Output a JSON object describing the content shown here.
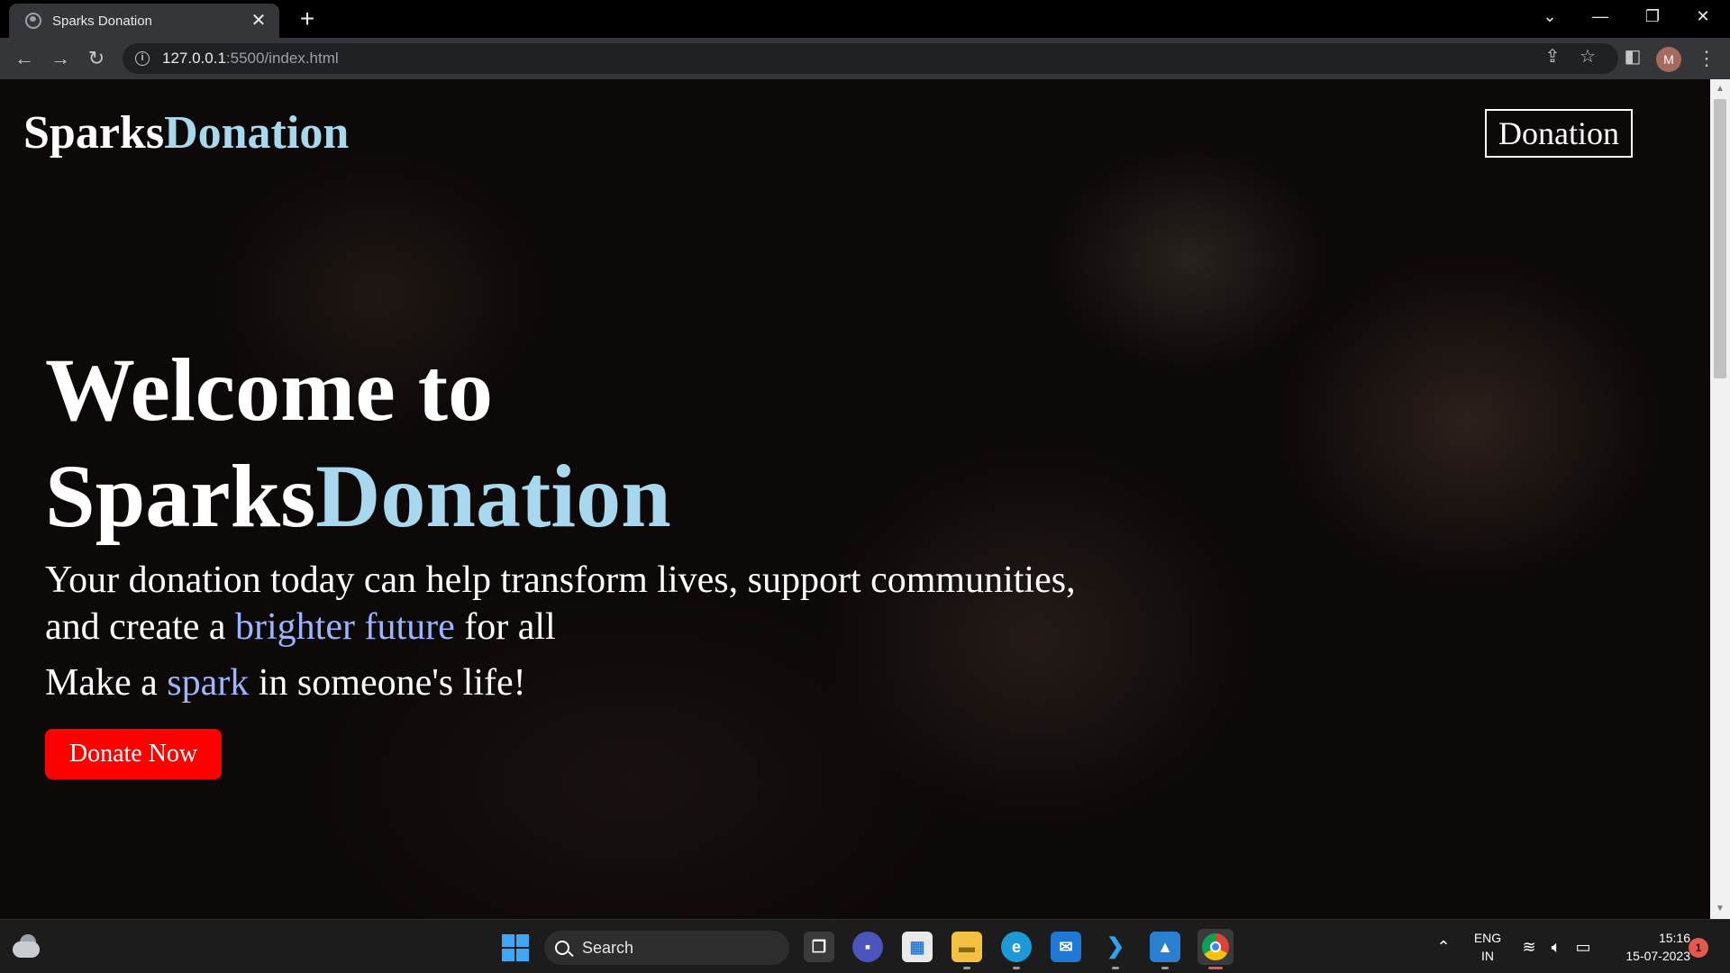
{
  "browser": {
    "tab_title": "Sparks Donation",
    "tab_close": "✕",
    "new_tab": "+",
    "url_host": "127.0.0.1",
    "url_path": ":5500/index.html",
    "profile_initial": "M"
  },
  "site": {
    "brand_part1": "Sparks",
    "brand_part2": "Donation",
    "nav_button": "Donation"
  },
  "hero": {
    "title_line1": "Welcome to",
    "title_part1": "Sparks",
    "title_part2": "Donation",
    "lead_line1": "Your donation today can help transform lives, support communities,",
    "lead_line2_pre": "and create a ",
    "lead_line2_highlight": "brighter future",
    "lead_line2_post": " for all",
    "spark_pre": "Make a ",
    "spark_highlight": "spark",
    "spark_post": " in someone's life!",
    "cta": "Donate Now"
  },
  "taskbar": {
    "search_label": "Search",
    "lang_line1": "ENG",
    "lang_line2": "IN",
    "time": "15:16",
    "date": "15-07-2023",
    "notification_count": "1"
  },
  "colors": {
    "accent_blue": "#a8d8ee",
    "highlight_blue": "#9bb5ff",
    "cta_red": "#ff0000"
  },
  "icons": [
    "back-icon",
    "forward-icon",
    "reload-icon",
    "info-icon",
    "share-icon",
    "star-icon",
    "sidepanel-icon",
    "menu-icon",
    "weather-icon",
    "windows-start-icon",
    "search-icon",
    "task-view-icon",
    "teams-chat-icon",
    "store-icon",
    "file-explorer-icon",
    "edge-icon",
    "mail-icon",
    "vscode-icon",
    "photos-icon",
    "chrome-icon",
    "wifi-icon",
    "volume-icon",
    "battery-icon"
  ]
}
